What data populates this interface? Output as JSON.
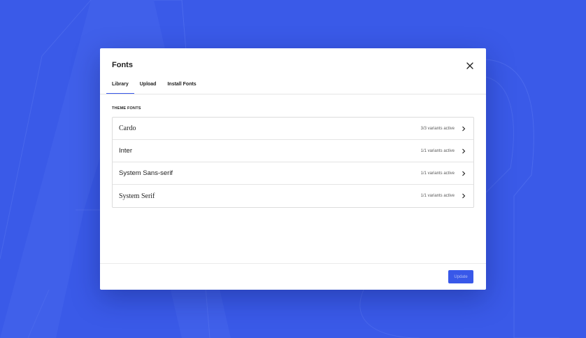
{
  "modal": {
    "title": "Fonts",
    "close_icon": "close-icon",
    "tabs": [
      {
        "label": "Library",
        "active": true
      },
      {
        "label": "Upload",
        "active": false
      },
      {
        "label": "Install Fonts",
        "active": false
      }
    ],
    "section_heading": "THEME FONTS",
    "fonts": [
      {
        "name": "Cardo",
        "variants": "3/3 variants active",
        "style": "serif"
      },
      {
        "name": "Inter",
        "variants": "1/1 variants active",
        "style": "sans"
      },
      {
        "name": "System Sans-serif",
        "variants": "1/1 variants active",
        "style": "sans"
      },
      {
        "name": "System Serif",
        "variants": "1/1 variants active",
        "style": "serif"
      }
    ],
    "footer": {
      "update_label": "Update"
    }
  },
  "colors": {
    "background": "#3a5ae8",
    "accent": "#3858e9",
    "modal_background": "#ffffff"
  },
  "icons": {
    "row_chevron": "chevron-right-icon",
    "close": "close-icon"
  }
}
